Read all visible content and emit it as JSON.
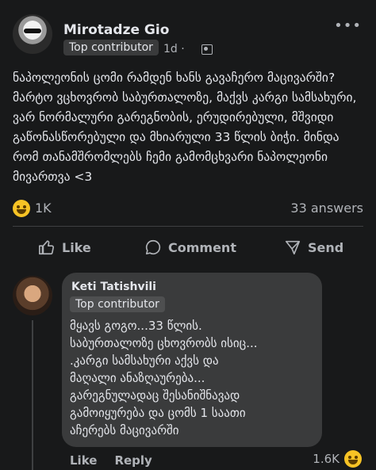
{
  "post": {
    "author": "Mirotadze Gio",
    "badge": "Top contributor",
    "time": "1d ·",
    "text": "ნაპოლეონის ცომი რამდენ ხანს გავაჩერო მაცივარში? მარტო ვცხოვრობ საბურთალოზე, მაქვს კარგი სამსახური, ვარ ნორმალური გარეგნობის, ერუდირებული, მშვიდი გაწონასწორებული და მხიარული 33 წლის ბიჭი. მინდა რომ თანამშრომლებს ჩემი გამომცხვარი ნაპოლეონი მივართვა <3",
    "reaction_count": "1K",
    "answers": "33 answers"
  },
  "actions": {
    "like": "Like",
    "comment": "Comment",
    "send": "Send"
  },
  "comment": {
    "author": "Keti Tatishvili",
    "badge": "Top contributor",
    "text": "მყავს გოგო...33 წლის.\nსაბურთალოზე ცხოვრობს ისიც...\n.კარგი სამსახური აქვს და\nმაღალი ანაზღაურება...\nგარეგნულადაც შესანიშნავად\nგამოიყურება და ცომს 1 საათი\nაჩერებს მაცივარში",
    "like": "Like",
    "reply": "Reply",
    "reaction_count": "1.6K"
  },
  "colors": {
    "background": "#18191a",
    "bubble": "#3a3b3c",
    "text": "#e4e6eb",
    "muted": "#b0b3b8"
  },
  "icons": [
    "more-icon",
    "privacy-icon",
    "laugh-emoji-icon",
    "thumbs-up-icon",
    "comment-icon",
    "send-icon"
  ]
}
